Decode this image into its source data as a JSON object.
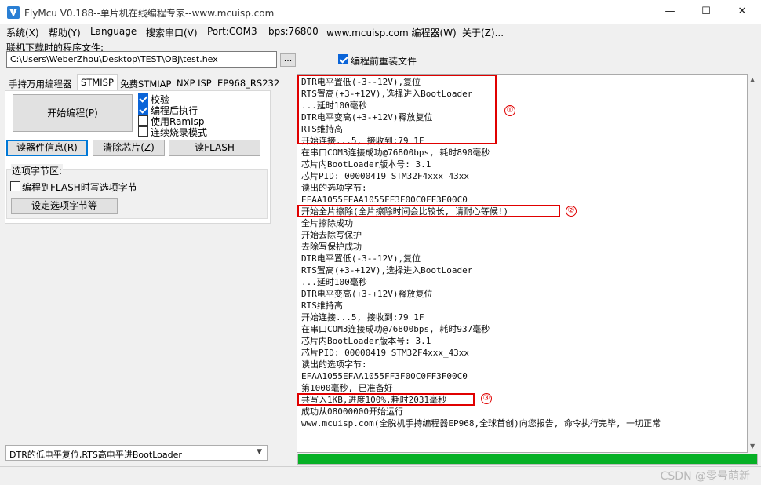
{
  "window": {
    "title": "FlyMcu V0.188--单片机在线编程专家--www.mcuisp.com",
    "minimize": "—",
    "maximize": "☐",
    "close": "✕"
  },
  "menu": [
    "系统(X)",
    "帮助(Y)",
    "Language",
    "搜索串口(V)",
    "Port:COM3",
    "bps:76800",
    "www.mcuisp.com 编程器(W)",
    "关于(Z)..."
  ],
  "file": {
    "label": "联机下载时的程序文件:",
    "path": "C:\\Users\\WeberZhou\\Desktop\\TEST\\OBJ\\test.hex",
    "browse_label": "...",
    "reload_label": "编程前重装文件",
    "reload_checked": true
  },
  "tabs": [
    "手持万用编程器",
    "STMISP",
    "免费STMIAP",
    "NXP ISP",
    "EP968_RS232"
  ],
  "active_tab": 1,
  "stmisp": {
    "start_label": "开始编程(P)",
    "options": [
      {
        "label": "校验",
        "checked": true
      },
      {
        "label": "编程后执行",
        "checked": true
      },
      {
        "label": "使用RamIsp",
        "checked": false
      },
      {
        "label": "连续烧录模式",
        "checked": false
      }
    ],
    "read_info_label": "读器件信息(R)",
    "erase_label": "清除芯片(Z)",
    "read_flash_label": "读FLASH",
    "option_group_label": "选项字节区:",
    "write_option_label": "编程到FLASH时写选项字节",
    "write_option_checked": false,
    "set_option_label": "设定选项字节等"
  },
  "reset_mode": "DTR的低电平复位,RTS高电平进BootLoader",
  "log_lines": [
    "DTR电平置低(-3--12V),复位",
    "RTS置高(+3-+12V),选择进入BootLoader",
    "...延时100毫秒",
    "DTR电平变高(+3-+12V)释放复位",
    "RTS维持高",
    "开始连接...5, 接收到:79 1F",
    "在串口COM3连接成功@76800bps, 耗时890毫秒",
    "芯片内BootLoader版本号: 3.1",
    "芯片PID: 00000419  STM32F4xxx_43xx",
    "读出的选项字节:",
    "EFAA1055EFAA1055FF3F00C0FF3F00C0",
    "开始全片擦除(全片擦除时间会比较长, 请耐心等候!)",
    "全片擦除成功",
    "开始去除写保护",
    "去除写保护成功",
    "DTR电平置低(-3--12V),复位",
    "RTS置高(+3-+12V),选择进入BootLoader",
    "...延时100毫秒",
    "DTR电平变高(+3-+12V)释放复位",
    "RTS维持高",
    "开始连接...5, 接收到:79 1F",
    "在串口COM3连接成功@76800bps, 耗时937毫秒",
    "芯片内BootLoader版本号: 3.1",
    "芯片PID: 00000419  STM32F4xxx_43xx",
    "读出的选项字节:",
    "EFAA1055EFAA1055FF3F00C0FF3F00C0",
    "第1000毫秒, 已准备好",
    "共写入1KB,进度100%,耗时2031毫秒",
    "成功从08000000开始运行",
    "www.mcuisp.com(全脱机手持编程器EP968,全球首创)向您报告, 命令执行完毕, 一切正常"
  ],
  "annotations": [
    {
      "label": "①",
      "color": "#e00000"
    },
    {
      "label": "②",
      "color": "#e00000"
    },
    {
      "label": "③",
      "color": "#e00000"
    }
  ],
  "progress": {
    "percent": 100,
    "color": "#06b025"
  },
  "watermark": "CSDN @零号萌新"
}
